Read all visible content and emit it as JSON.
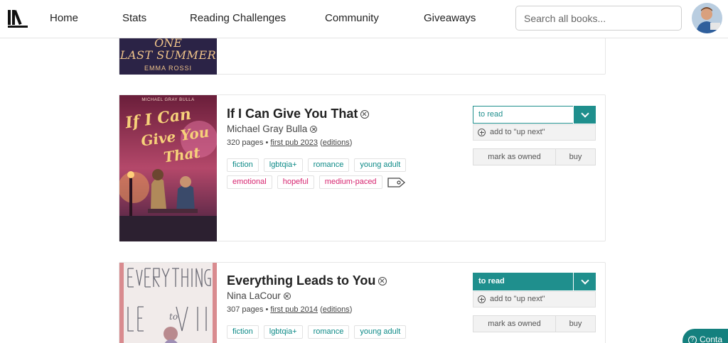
{
  "nav": {
    "home": "Home",
    "stats": "Stats",
    "reading_challenges": "Reading Challenges",
    "community": "Community",
    "giveaways": "Giveaways",
    "search_placeholder": "Search all books..."
  },
  "top_card": {
    "cover_line1": "ONE",
    "cover_line2": "LAST SUMMER",
    "cover_author": "EMMA ROSSI"
  },
  "books": [
    {
      "title": "If I Can Give You That",
      "author": "Michael Gray Bulla",
      "pages": "320 pages",
      "sep": "•",
      "first_pub": "first pub 2023",
      "editions": "editions",
      "genres": [
        "fiction",
        "lgbtqia+",
        "romance",
        "young adult"
      ],
      "moods": [
        "emotional",
        "hopeful",
        "medium-paced"
      ],
      "status": "to read",
      "up_next": "add to \"up next\"",
      "owned": "mark as owned",
      "buy": "buy",
      "cover_author": "MICHAEL GRAY BULLA",
      "cover_title_1": "If I Can",
      "cover_title_2": "Give You",
      "cover_title_3": "That"
    },
    {
      "title": "Everything Leads to You",
      "author": "Nina LaCour",
      "pages": "307 pages",
      "sep": "•",
      "first_pub": "first pub 2014",
      "editions": "editions",
      "genres": [
        "fiction",
        "lgbtqia+",
        "romance",
        "young adult"
      ],
      "status": "to read",
      "up_next": "add to \"up next\"",
      "owned": "mark as owned",
      "buy": "buy"
    }
  ],
  "contact": "Conta",
  "colors": {
    "teal": "#1f8f8d",
    "pink": "#d6246f"
  }
}
